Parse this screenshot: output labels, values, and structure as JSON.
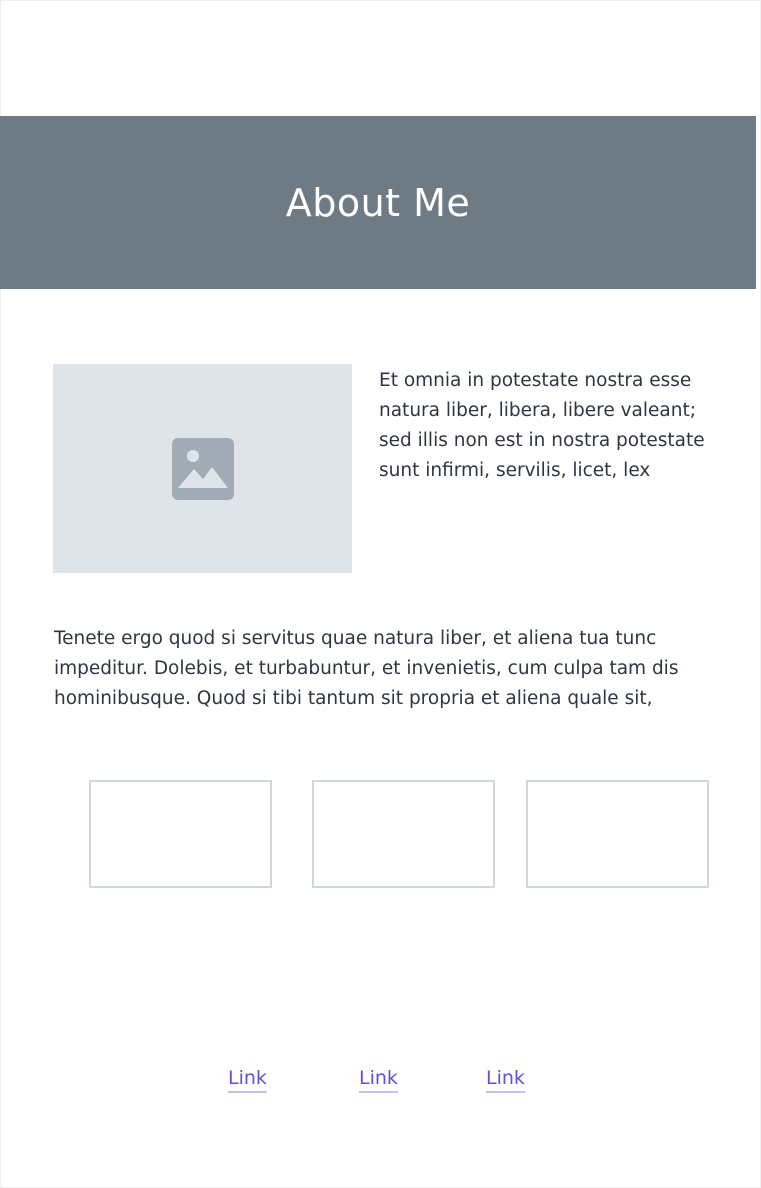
{
  "hero": {
    "title": "About Me",
    "background_color": "#6e7a84"
  },
  "intro": {
    "image_icon": "image-icon",
    "text": "Et omnia in potestate nostra esse natura liber, libera, libere valeant; sed illis non est in nostra potestate sunt infirmi, servilis, licet, lex"
  },
  "body": {
    "text": "Tenete ergo quod si servitus quae natura liber, et aliena tua tunc impeditur. Dolebis, et turbabuntur, et invenietis, cum culpa tam dis hominibusque. Quod si tibi tantum sit propria et aliena quale sit,"
  },
  "cards": [
    {
      "label": ""
    },
    {
      "label": ""
    },
    {
      "label": ""
    }
  ],
  "footer": {
    "links": [
      {
        "label": "Link"
      },
      {
        "label": "Link"
      },
      {
        "label": "Link"
      }
    ],
    "link_color": "#5b52e0"
  }
}
